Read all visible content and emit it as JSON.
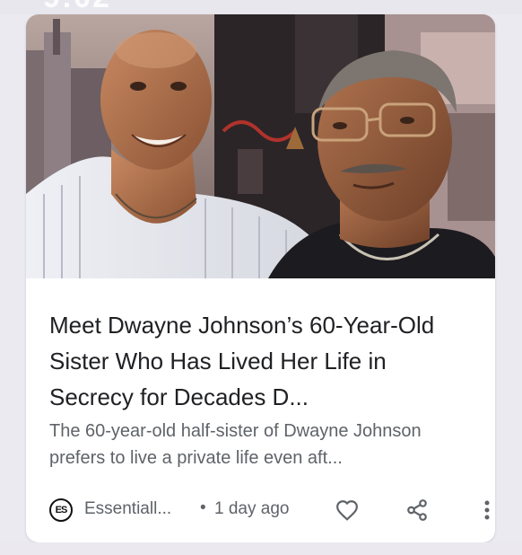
{
  "article": {
    "headline": "Meet Dwayne Johnson’s 60-Year-Old Sister Who Has Lived Her Life in Secrecy for Decades D...",
    "snippet": "The 60-year-old half-sister of Dwayne Johnson prefers to live a private life even aft...",
    "source": {
      "logo_text": "ES",
      "name": "Essentiall...",
      "separator": "•",
      "time_ago": "1 day ago"
    },
    "actions": {
      "like_icon": "heart-icon",
      "share_icon": "share-icon",
      "more_icon": "more-vert-icon"
    }
  },
  "colors": {
    "card_bg": "#ffffff",
    "page_bg": "#eceaf1",
    "headline": "#202124",
    "secondary_text": "#5f6368"
  }
}
